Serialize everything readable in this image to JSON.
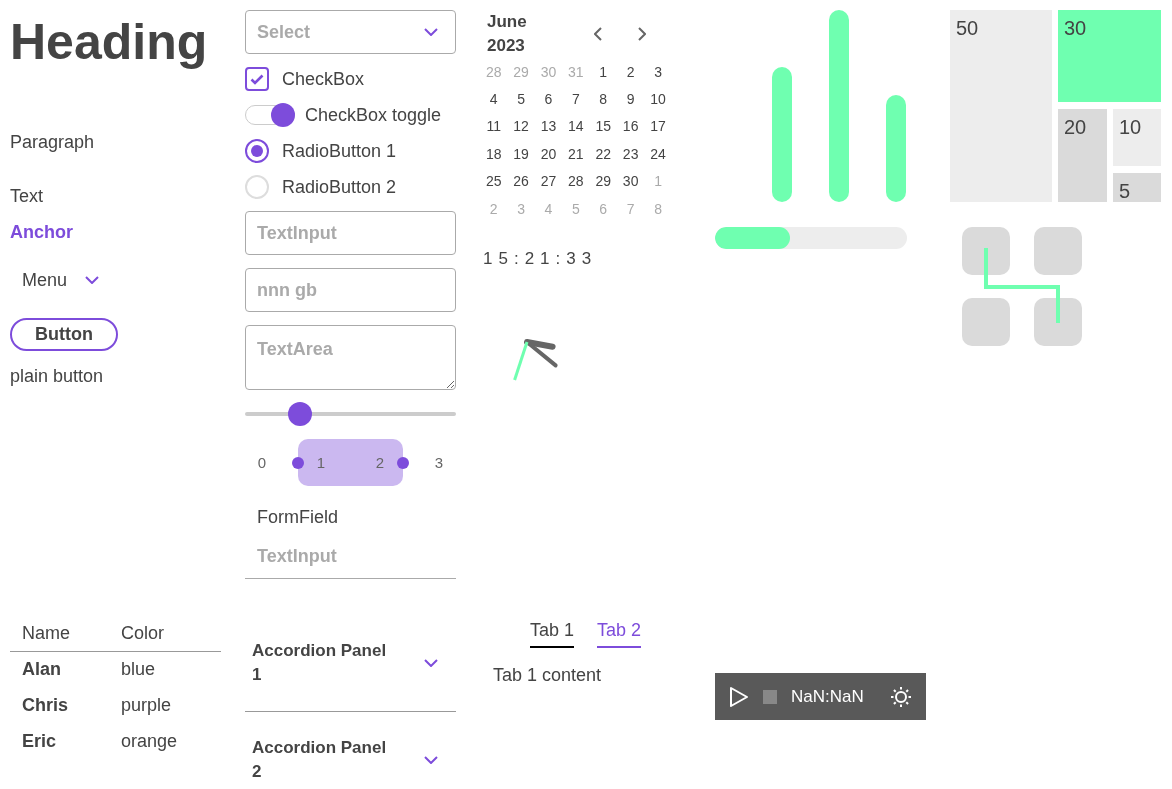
{
  "heading": "Heading",
  "paragraph": "Paragraph",
  "text": "Text",
  "anchor": "Anchor",
  "menu": {
    "label": "Menu"
  },
  "button": {
    "label": "Button"
  },
  "plain_button": {
    "label": "plain button"
  },
  "select": {
    "placeholder": "Select"
  },
  "checkbox": {
    "label": "CheckBox",
    "checked": true
  },
  "toggle": {
    "label": "CheckBox toggle",
    "on": true
  },
  "radio_buttons": [
    {
      "label": "RadioButton 1",
      "selected": true
    },
    {
      "label": "RadioButton 2",
      "selected": false
    }
  ],
  "text_input": {
    "placeholder": "TextInput"
  },
  "masked_input": {
    "placeholder": "nnn gb"
  },
  "text_area": {
    "placeholder": "TextArea"
  },
  "slider": {
    "level": 0.23
  },
  "range_selector": {
    "labels": [
      {
        "label": "0",
        "selected": false
      },
      {
        "label": "1",
        "selected": true
      },
      {
        "label": "2",
        "selected": true
      },
      {
        "label": "3",
        "selected": false
      }
    ]
  },
  "form_field": {
    "label": "FormField",
    "placeholder": "TextInput"
  },
  "calendar": {
    "title": "June 2023",
    "days": [
      {
        "label": "28",
        "in_month": false
      },
      {
        "label": "29",
        "in_month": false
      },
      {
        "label": "30",
        "in_month": false
      },
      {
        "label": "31",
        "in_month": false
      },
      {
        "label": "1",
        "in_month": true
      },
      {
        "label": "2",
        "in_month": true
      },
      {
        "label": "3",
        "in_month": true
      },
      {
        "label": "4",
        "in_month": true
      },
      {
        "label": "5",
        "in_month": true
      },
      {
        "label": "6",
        "in_month": true
      },
      {
        "label": "7",
        "in_month": true
      },
      {
        "label": "8",
        "in_month": true
      },
      {
        "label": "9",
        "in_month": true
      },
      {
        "label": "10",
        "in_month": true
      },
      {
        "label": "11",
        "in_month": true
      },
      {
        "label": "12",
        "in_month": true
      },
      {
        "label": "13",
        "in_month": true
      },
      {
        "label": "14",
        "in_month": true
      },
      {
        "label": "15",
        "in_month": true
      },
      {
        "label": "16",
        "in_month": true
      },
      {
        "label": "17",
        "in_month": true
      },
      {
        "label": "18",
        "in_month": true
      },
      {
        "label": "19",
        "in_month": true
      },
      {
        "label": "20",
        "in_month": true
      },
      {
        "label": "21",
        "in_month": true
      },
      {
        "label": "22",
        "in_month": true
      },
      {
        "label": "23",
        "in_month": true
      },
      {
        "label": "24",
        "in_month": true
      },
      {
        "label": "25",
        "in_month": true
      },
      {
        "label": "26",
        "in_month": true
      },
      {
        "label": "27",
        "in_month": true
      },
      {
        "label": "28",
        "in_month": true
      },
      {
        "label": "29",
        "in_month": true
      },
      {
        "label": "30",
        "in_month": true
      },
      {
        "label": "1",
        "in_month": false
      },
      {
        "label": "2",
        "in_month": false
      },
      {
        "label": "3",
        "in_month": false
      },
      {
        "label": "4",
        "in_month": false
      },
      {
        "label": "5",
        "in_month": false
      },
      {
        "label": "6",
        "in_month": false
      },
      {
        "label": "7",
        "in_month": false
      },
      {
        "label": "8",
        "in_month": false
      }
    ]
  },
  "digital_clock": "15:21:33",
  "meter": {
    "level": 0.39
  },
  "treemap": {
    "cells": [
      {
        "label": "50",
        "color": "#ededed"
      },
      {
        "label": "30",
        "color": "#6fffb0"
      },
      {
        "label": "20",
        "color": "#dadada"
      },
      {
        "label": "10",
        "color": "#ededed"
      },
      {
        "label": "5",
        "color": "#dadada"
      }
    ]
  },
  "table": {
    "columns": [
      "Name",
      "Color"
    ],
    "rows": [
      [
        "Alan",
        "blue"
      ],
      [
        "Chris",
        "purple"
      ],
      [
        "Eric",
        "orange"
      ]
    ]
  },
  "accordion": {
    "panels": [
      {
        "label": "Accordion Panel 1",
        "expanded": false
      },
      {
        "label": "Accordion Panel 2",
        "expanded": false
      }
    ]
  },
  "tabs": {
    "items": [
      {
        "label": "Tab 1",
        "selected": true
      },
      {
        "label": "Tab 2",
        "selected": false
      }
    ],
    "content": "Tab 1 content"
  },
  "video_controls": {
    "time": "NaN:NaN"
  }
}
